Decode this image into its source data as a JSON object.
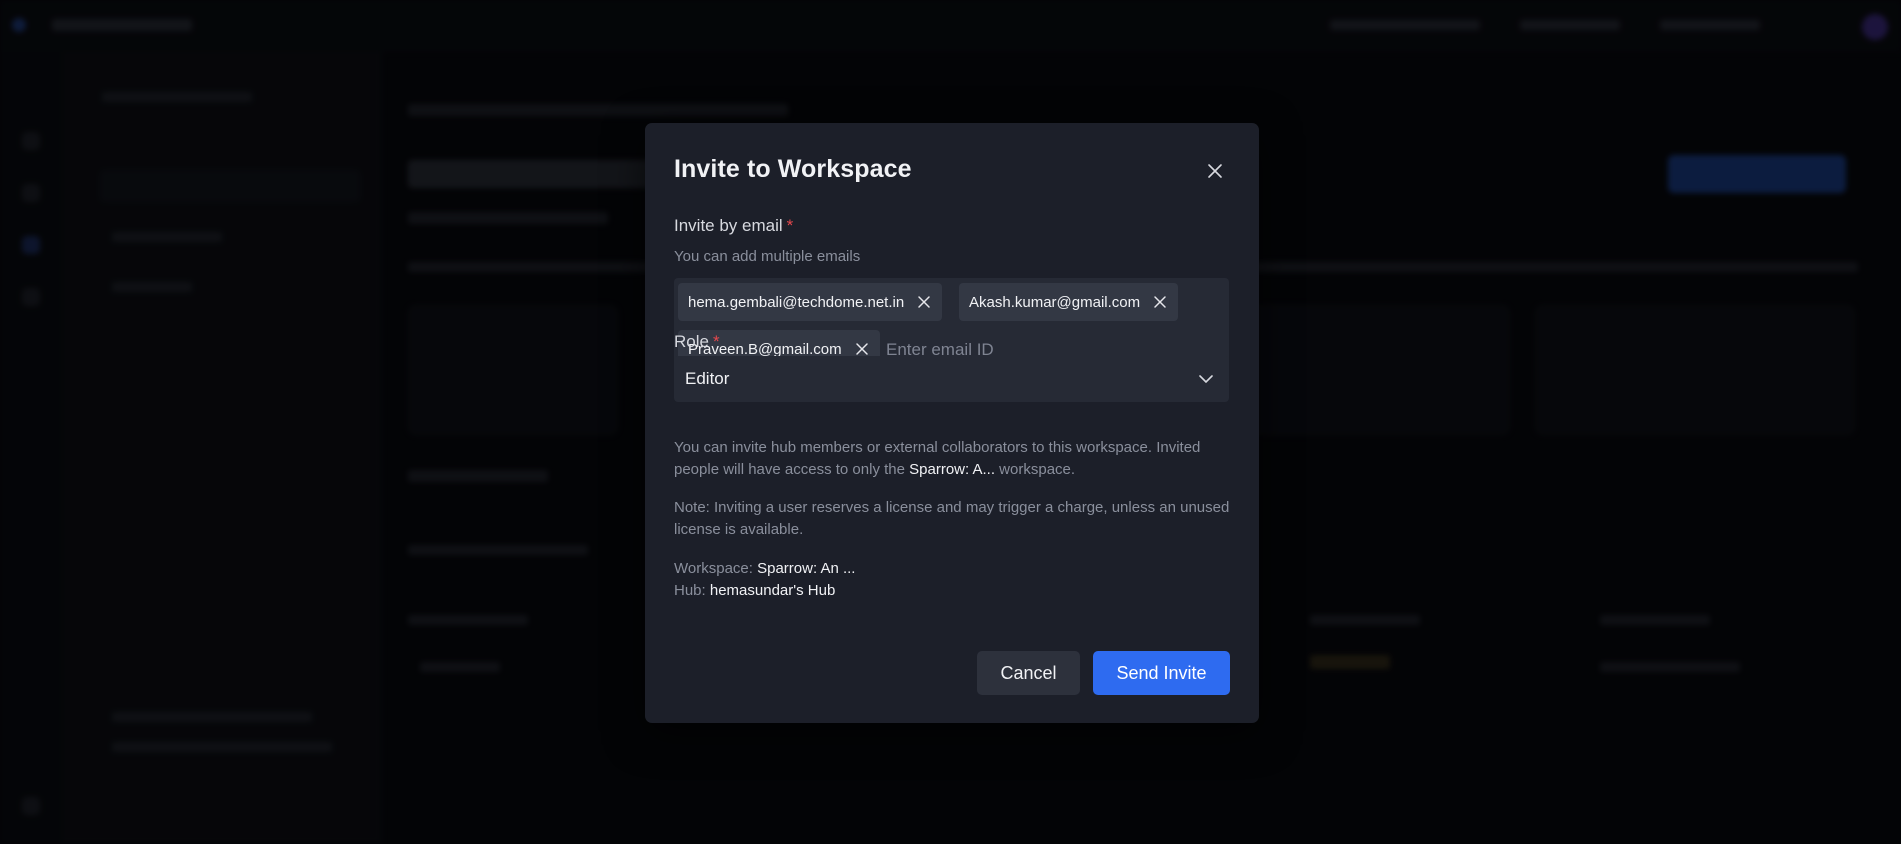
{
  "modal": {
    "title": "Invite to Workspace",
    "close_icon": "close-icon"
  },
  "invite_by_email": {
    "label": "Invite by email",
    "required_mark": "*",
    "hint": "You can add multiple emails",
    "emails": [
      "hema.gembali@techdome.net.in",
      "Akash.kumar@gmail.com",
      "Praveen.B@gmail.com"
    ],
    "remove_icon": "close-icon",
    "input_placeholder": "Enter email ID"
  },
  "role": {
    "label": "Role",
    "required_mark": "*",
    "selected": "Editor",
    "chevron_icon": "chevron-down-icon"
  },
  "info": {
    "line_prefix": "You can invite hub members or external collaborators to this workspace. Invited people will have access to only the ",
    "workspace_short": "Sparrow: A...",
    "line_suffix": " workspace.",
    "note": "Note: Inviting a user reserves a license and may trigger a charge, unless an unused license is available."
  },
  "footer": {
    "workspace_label": "Workspace:",
    "workspace_value": "Sparrow: An ...",
    "hub_label": "Hub:",
    "hub_value": "hemasundar's Hub",
    "cancel_label": "Cancel",
    "send_label": "Send Invite"
  },
  "colors": {
    "accent": "#2e6bf0",
    "required": "#e5484d",
    "modal_bg": "#1c1f29"
  }
}
